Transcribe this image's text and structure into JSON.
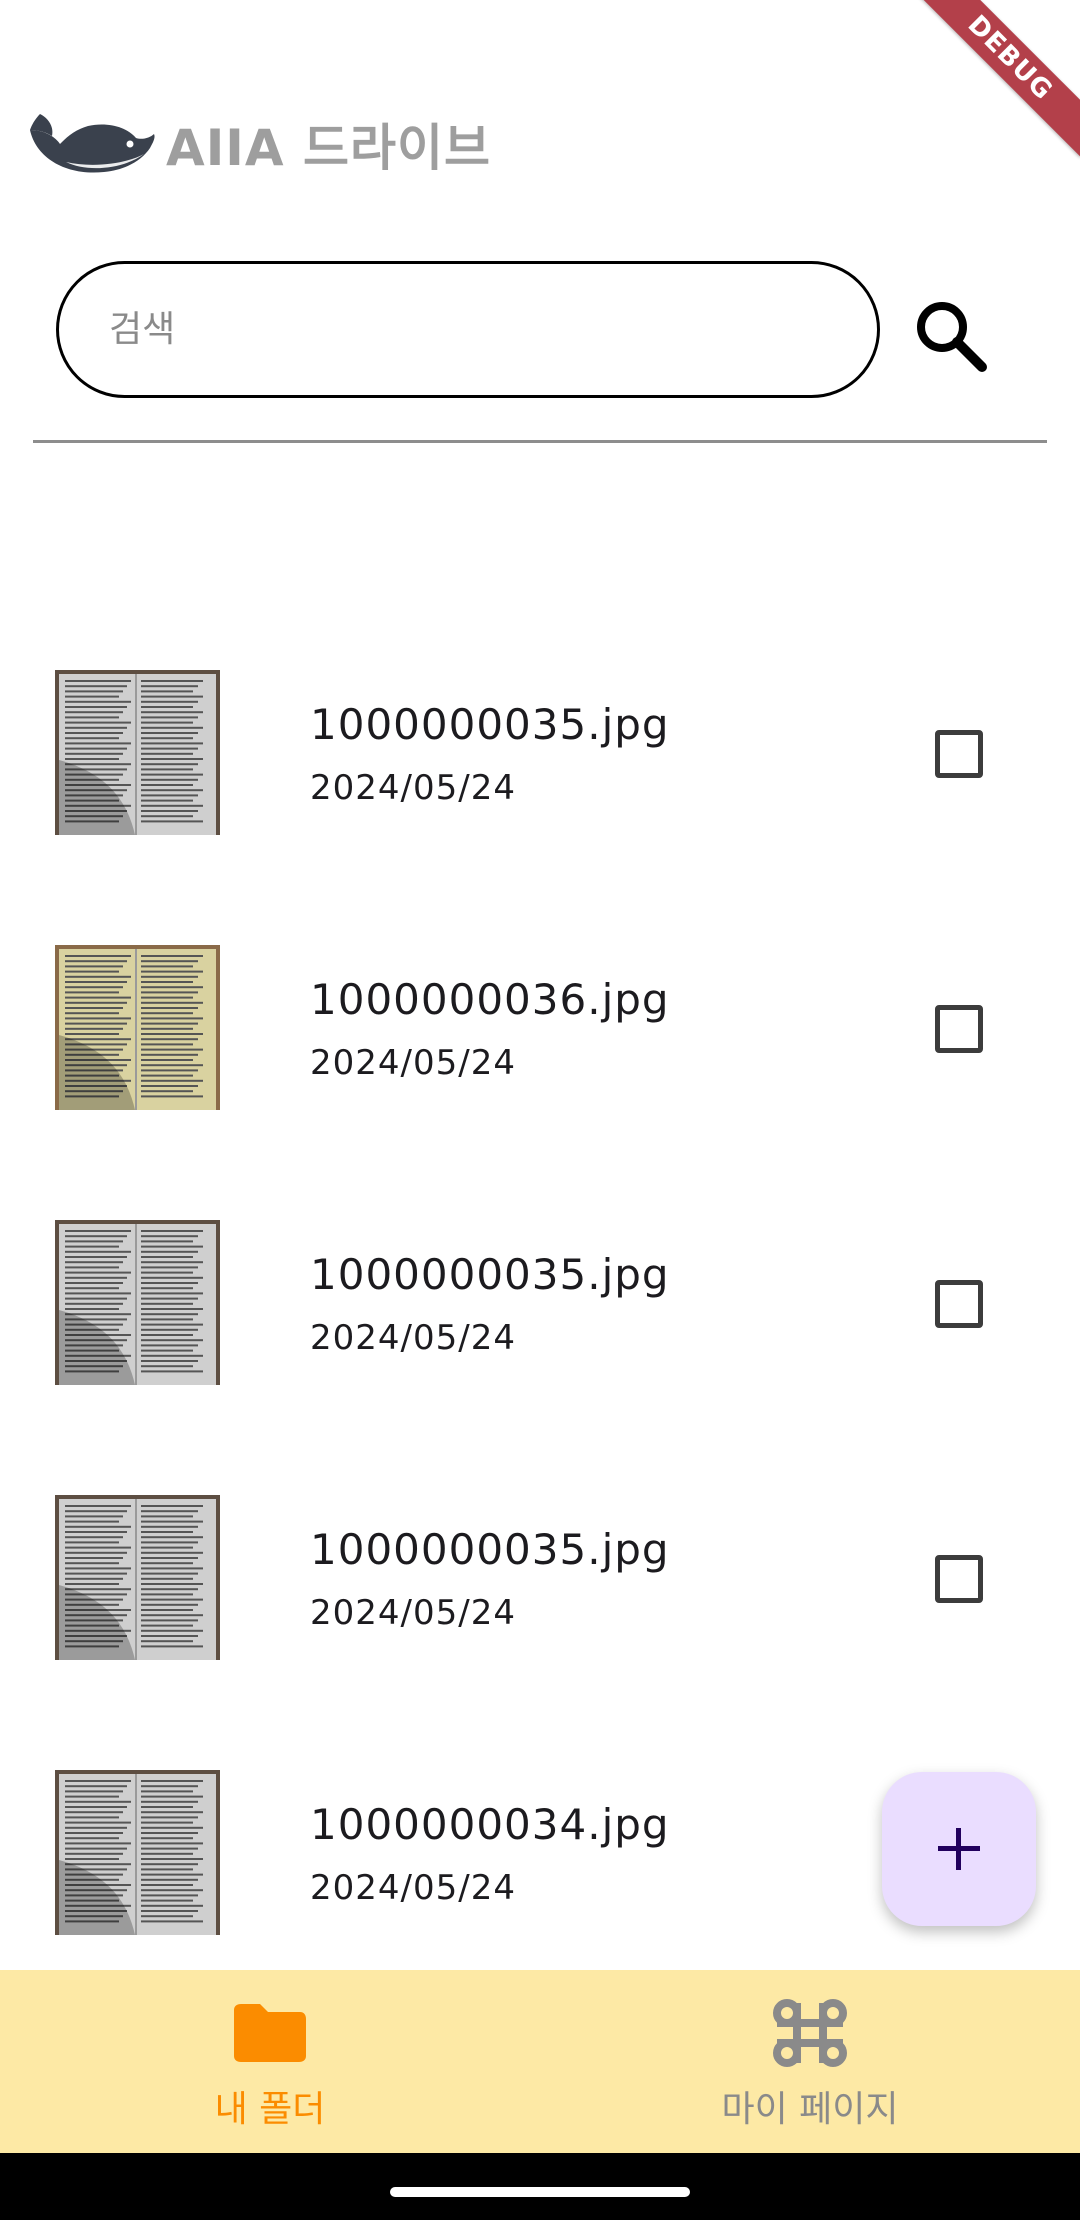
{
  "debug_ribbon": "DEBUG",
  "app": {
    "title": "AIIA 드라이브"
  },
  "search": {
    "placeholder": "검색",
    "value": ""
  },
  "files": [
    {
      "name": "1000000035.jpg",
      "date": "2024/05/24",
      "checked": false,
      "thumb_tone": "gray"
    },
    {
      "name": "1000000036.jpg",
      "date": "2024/05/24",
      "checked": false,
      "thumb_tone": "yellow"
    },
    {
      "name": "1000000035.jpg",
      "date": "2024/05/24",
      "checked": false,
      "thumb_tone": "gray"
    },
    {
      "name": "1000000035.jpg",
      "date": "2024/05/24",
      "checked": false,
      "thumb_tone": "gray"
    },
    {
      "name": "1000000034.jpg",
      "date": "2024/05/24",
      "checked": false,
      "thumb_tone": "gray"
    }
  ],
  "fab": {
    "icon": "plus-icon",
    "color": "#eaddff"
  },
  "bottom_nav": {
    "items": [
      {
        "label": "내 폴더",
        "icon": "folder-icon",
        "active": true
      },
      {
        "label": "마이 페이지",
        "icon": "command-icon",
        "active": false
      }
    ],
    "background": "#fde9a5",
    "active_color": "#fb8c00",
    "inactive_color": "#8a8a8a"
  }
}
